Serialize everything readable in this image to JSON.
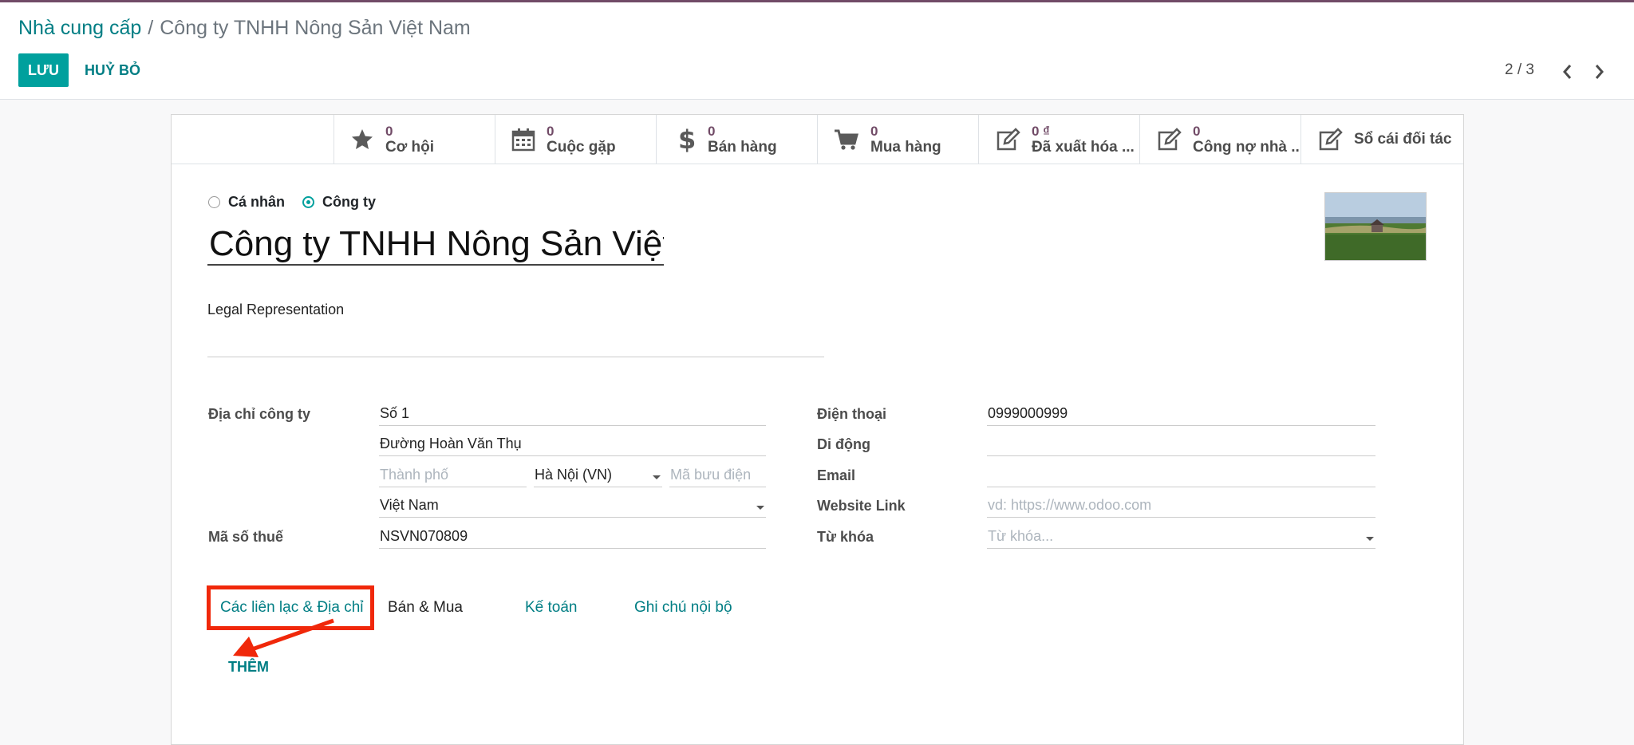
{
  "breadcrumb": {
    "parent": "Nhà cung cấp",
    "separator": "/",
    "current": "Công ty TNHH Nông Sản Việt Nam"
  },
  "toolbar": {
    "save_label": "LƯU",
    "discard_label": "HUỶ BỎ"
  },
  "pager": {
    "value": "2 / 3"
  },
  "smart_buttons": [
    {
      "icon": "star-icon",
      "value": "0",
      "label": "Cơ hội"
    },
    {
      "icon": "calendar-icon",
      "value": "0",
      "label": "Cuộc gặp"
    },
    {
      "icon": "dollar-icon",
      "value": "0",
      "label": "Bán hàng"
    },
    {
      "icon": "cart-icon",
      "value": "0",
      "label": "Mua hàng"
    },
    {
      "icon": "edit-icon",
      "value": "0 ₫",
      "label": "Đã xuất hóa ..."
    },
    {
      "icon": "edit-icon",
      "value": "0",
      "label": "Công nợ nhà ..."
    },
    {
      "icon": "edit-icon",
      "label": "Sổ cái đối tác"
    }
  ],
  "company_type": {
    "options": [
      "Cá nhân",
      "Công ty"
    ],
    "selected": "Công ty"
  },
  "name": "Công ty TNHH Nông Sản Việt",
  "legal_representation_label": "Legal Representation",
  "address": {
    "label": "Địa chỉ công ty",
    "street": "Số 1",
    "street2": "Đường Hoàn Văn Thụ",
    "city_placeholder": "Thành phố",
    "state": "Hà Nội (VN)",
    "zip_placeholder": "Mã bưu điện",
    "country": "Việt Nam"
  },
  "tax": {
    "label": "Mã số thuế",
    "value": "NSVN070809"
  },
  "contact": {
    "phone_label": "Điện thoại",
    "phone": "0999000999",
    "mobile_label": "Di động",
    "email_label": "Email",
    "website_label": "Website Link",
    "website_placeholder": "vd: https://www.odoo.com",
    "tags_label": "Từ khóa",
    "tags_placeholder": "Từ khóa..."
  },
  "tabs": [
    "Các liên lạc & Địa chỉ",
    "Bán & Mua",
    "Kế toán",
    "Ghi chú nội bộ"
  ],
  "add_label": "THÊM",
  "colors": {
    "brand": "#714B67",
    "accent": "#00a09d",
    "link": "#017e84",
    "highlight": "#f0280a"
  }
}
